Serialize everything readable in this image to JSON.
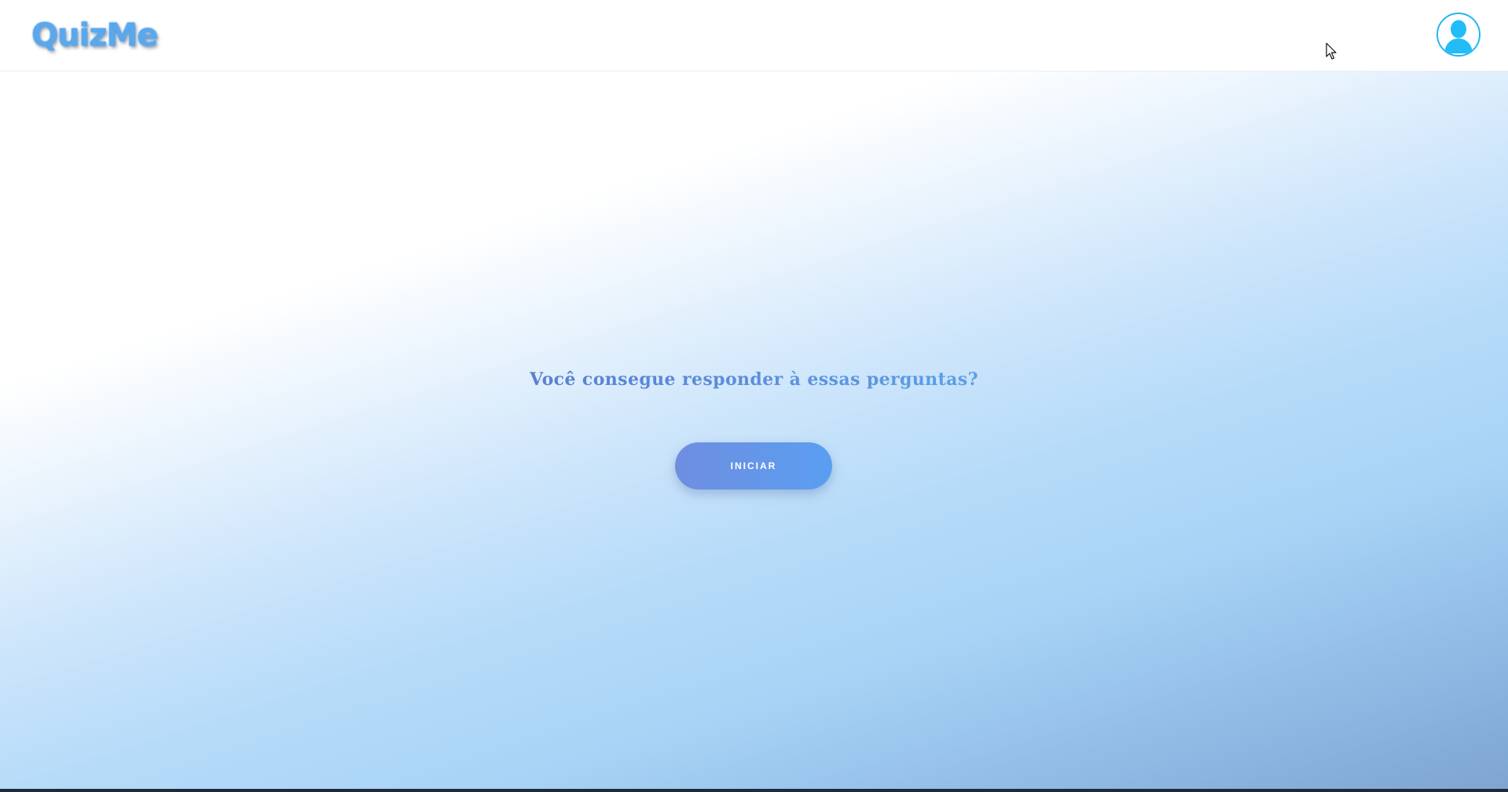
{
  "header": {
    "logo_text": "QuizMe",
    "avatar_icon": "user-avatar-icon",
    "avatar_border_color": "#1fb6f2"
  },
  "main": {
    "headline": "Você consegue responder à essas perguntas?",
    "start_button_label": "INICIAR"
  },
  "colors": {
    "accent": "#5a9ef1",
    "accent_start": "#6f8ee0",
    "logo": "#5aa8ec",
    "background_bottom": "#7ea4d2"
  }
}
